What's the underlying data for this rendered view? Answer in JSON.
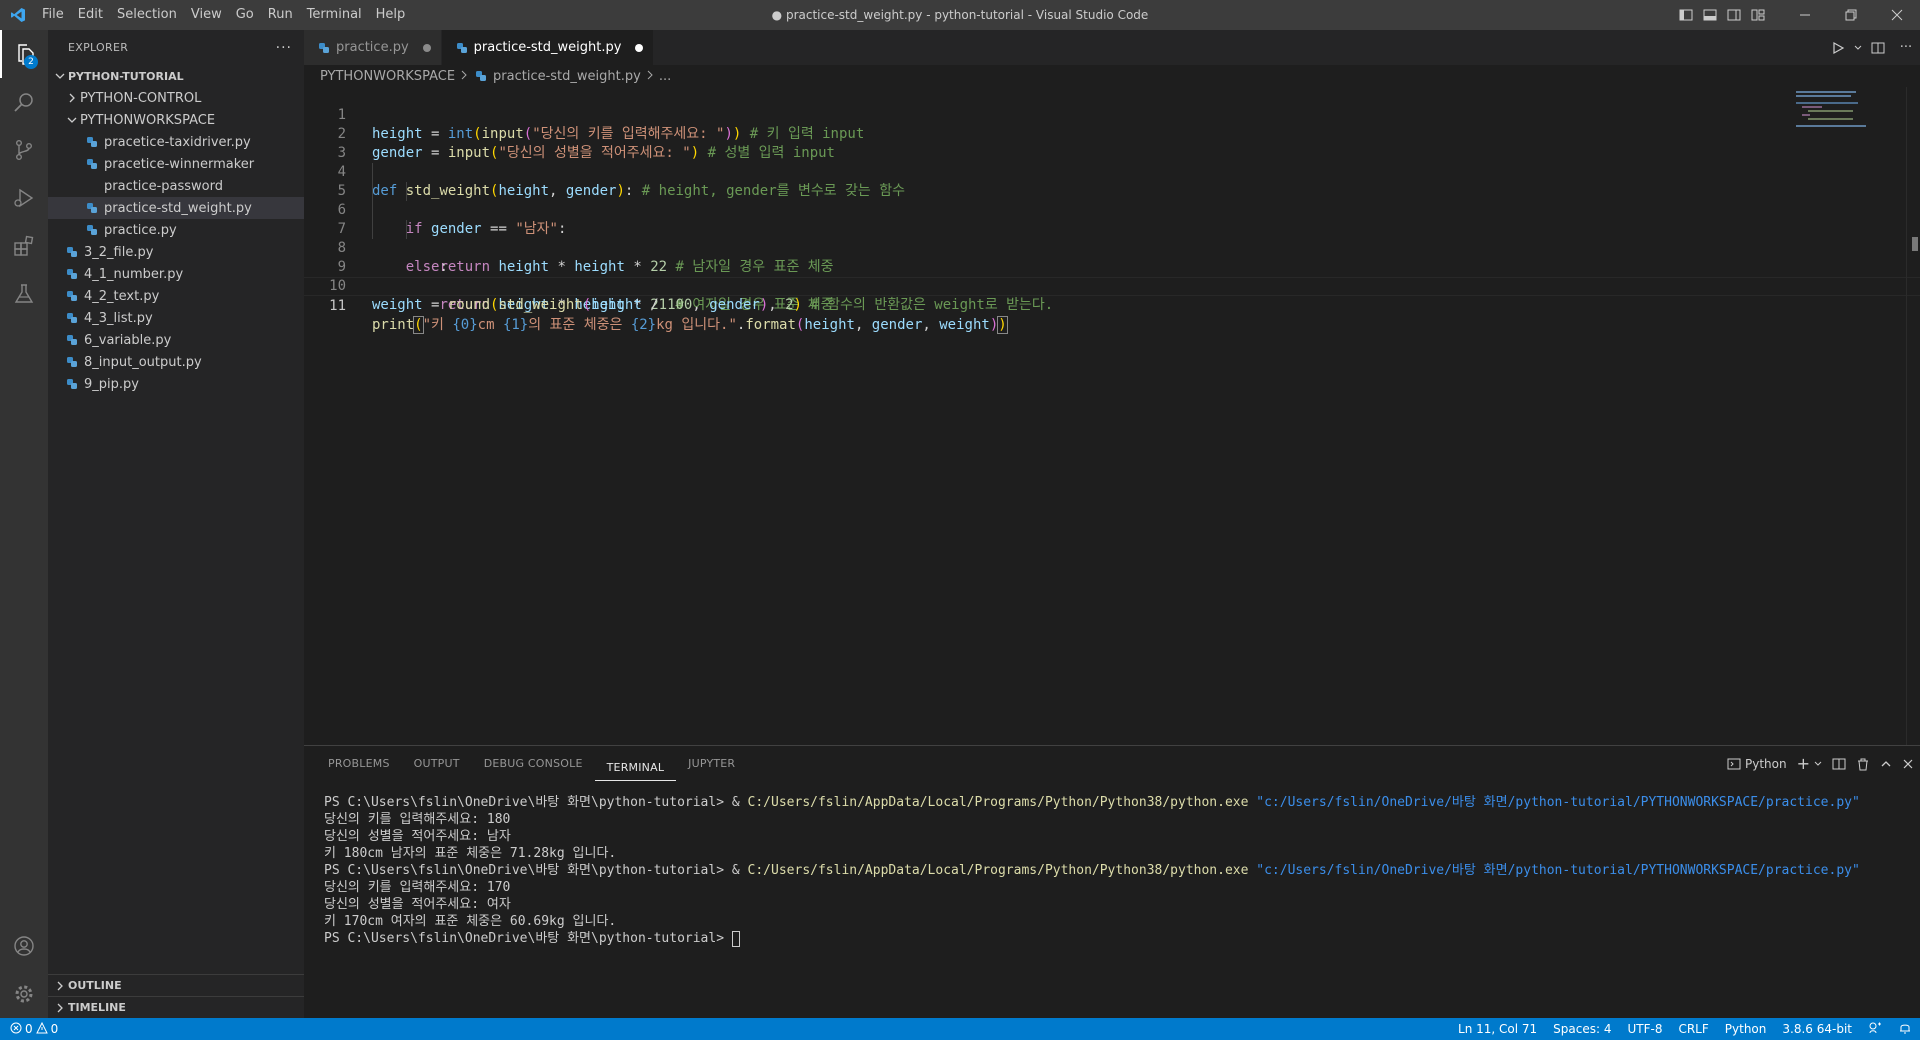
{
  "window": {
    "title": "● practice-std_weight.py - python-tutorial - Visual Studio Code"
  },
  "menu": [
    "File",
    "Edit",
    "Selection",
    "View",
    "Go",
    "Run",
    "Terminal",
    "Help"
  ],
  "activity": {
    "explorer_badge": "2"
  },
  "explorer": {
    "header": "EXPLORER",
    "root": "PYTHON-TUTORIAL",
    "folders": [
      {
        "label": "PYTHON-CONTROL",
        "expanded": false
      },
      {
        "label": "PYTHONWORKSPACE",
        "expanded": true
      }
    ],
    "workspace_files": [
      "pracetice-taxidriver.py",
      "pracetice-winnermaker",
      "practice-password",
      "practice-std_weight.py",
      "practice.py"
    ],
    "root_files": [
      "3_2_file.py",
      "4_1_number.py",
      "4_2_text.py",
      "4_3_list.py",
      "6_variable.py",
      "8_input_output.py",
      "9_pip.py"
    ],
    "outline": "OUTLINE",
    "timeline": "TIMELINE"
  },
  "tabs": [
    {
      "label": "practice.py",
      "active": false,
      "modified": true
    },
    {
      "label": "practice-std_weight.py",
      "active": true,
      "modified": true
    }
  ],
  "breadcrumb": {
    "folder": "PYTHONWORKSPACE",
    "file": "practice-std_weight.py",
    "more": "..."
  },
  "editor": {
    "line_numbers": [
      "1",
      "2",
      "3",
      "4",
      "5",
      "6",
      "7",
      "8",
      "9",
      "10",
      "11"
    ],
    "current_line": 11
  },
  "panel": {
    "tabs": [
      "PROBLEMS",
      "OUTPUT",
      "DEBUG CONSOLE",
      "TERMINAL",
      "JUPYTER"
    ],
    "active_tab": "TERMINAL",
    "shell": "Python",
    "prompt": "PS C:\\Users\\fslin\\OneDrive\\바탕 화면\\python-tutorial> ",
    "exe": "C:/Users/fslin/AppData/Local/Programs/Python/Python38/python.exe",
    "script": "\"c:/Users/fslin/OneDrive/바탕 화면/python-tutorial/PYTHONWORKSPACE/practice.py\"",
    "runs": [
      {
        "in1": "당신의 키를 입력해주세요: 180",
        "in2": "당신의 성별을 적어주세요: 남자",
        "out": "키 180cm 남자의 표준 체중은 71.28kg 입니다."
      },
      {
        "in1": "당신의 키를 입력해주세요: 170",
        "in2": "당신의 성별을 적어주세요: 여자",
        "out": "키 170cm 여자의 표준 체중은 60.69kg 입니다."
      }
    ]
  },
  "status": {
    "errors": "0",
    "warnings": "0",
    "position": "Ln 11, Col 71",
    "spaces": "Spaces: 4",
    "encoding": "UTF-8",
    "eol": "CRLF",
    "language": "Python",
    "interpreter": "3.8.6 64-bit"
  },
  "colors": {
    "accent": "#007acc",
    "titlebar": "#3c3c3c",
    "sidebar": "#252526",
    "editor": "#1e1e1e",
    "python_icon": "#3c8cc8"
  }
}
